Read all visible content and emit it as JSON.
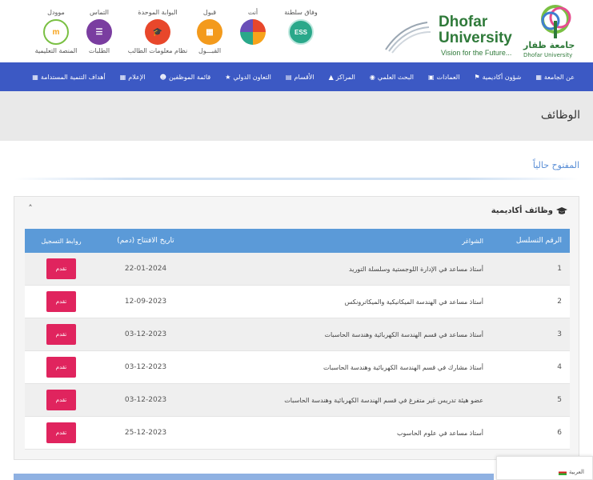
{
  "header": {
    "logo": {
      "name_en": "Dhofar University",
      "name_en_line1": "Dhofar",
      "name_en_line2": "University",
      "tagline": "Vision for the Future...",
      "name_ar": "جامعة ظفار",
      "name_en_small": "Dhofar University"
    },
    "quick_links": [
      {
        "title": "موودل",
        "label": "المنصة التعليمية",
        "color": "#f7a31b",
        "icon_text": "m",
        "icon": "moodle-icon"
      },
      {
        "title": "التماس",
        "label": "الطلبات",
        "color": "#7a3da0",
        "icon_text": "☰",
        "icon": "petition-icon"
      },
      {
        "title": "البوابة الموحدة",
        "label": "نظام معلومات الطالب",
        "color": "#e8472b",
        "icon_text": "🎓",
        "icon": "portal-icon"
      },
      {
        "title": "قبول",
        "label": "القبـــول",
        "color": "#f39a1c",
        "icon_text": "▦",
        "icon": "admission-icon"
      },
      {
        "title": "أنت",
        "label": "",
        "color": "#6a4fb8",
        "icon_text": "",
        "icon": "you-icon"
      },
      {
        "title": "وفاق سلطنة",
        "label": "",
        "color": "#2aa88a",
        "icon_text": "ESS",
        "icon": "ess-icon"
      }
    ]
  },
  "nav": {
    "items": [
      {
        "label": "عن الجامعة",
        "icon": "▦"
      },
      {
        "label": "شؤون أكاديمية",
        "icon": "⚑"
      },
      {
        "label": "العمادات",
        "icon": "▣"
      },
      {
        "label": "البحث العلمي",
        "icon": "◉"
      },
      {
        "label": "المراكز",
        "icon": "▲"
      },
      {
        "label": "الأقسام",
        "icon": "▤"
      },
      {
        "label": "التعاون الدولي",
        "icon": "★"
      },
      {
        "label": "قائمة الموظفين",
        "icon": "☻"
      },
      {
        "label": "الإعلام",
        "icon": "▦"
      },
      {
        "label": "أهداف التنمية المستدامة",
        "icon": "▦"
      }
    ]
  },
  "page": {
    "title": "الوظائف",
    "section_heading": "المفتوح حالياً"
  },
  "panel": {
    "heading": "وظائف أكاديمية",
    "toggle": "˄",
    "table": {
      "headers": {
        "num": "الرقم التسلسل",
        "title": "الشواغر",
        "date": "تاريخ الافتتاح (دمم)",
        "link": "روابط التسجيل"
      },
      "apply_label": "تقدم",
      "rows": [
        {
          "num": "1",
          "title": "أستاذ مساعد في الإدارة اللوجستية وسلسلة التوريد",
          "date": "22-01-2024"
        },
        {
          "num": "2",
          "title": "أستاذ مساعد في الهندسة الميكانيكية والميكاترونكس",
          "date": "12-09-2023"
        },
        {
          "num": "3",
          "title": "أستاذ مساعد في قسم الهندسة الكهربائية وهندسة الحاسبات",
          "date": "03-12-2023"
        },
        {
          "num": "4",
          "title": "أستاذ مشارك في قسم الهندسة الكهربائية وهندسة الحاسبات",
          "date": "03-12-2023"
        },
        {
          "num": "5",
          "title": "عضو هيئة تدريس غير متفرغ في قسم الهندسة الكهربائية وهندسة الحاسبات",
          "date": "03-12-2023"
        },
        {
          "num": "6",
          "title": "أستاذ مساعد في علوم الحاسوب",
          "date": "25-12-2023"
        }
      ]
    }
  },
  "language": {
    "label": "العربية"
  }
}
